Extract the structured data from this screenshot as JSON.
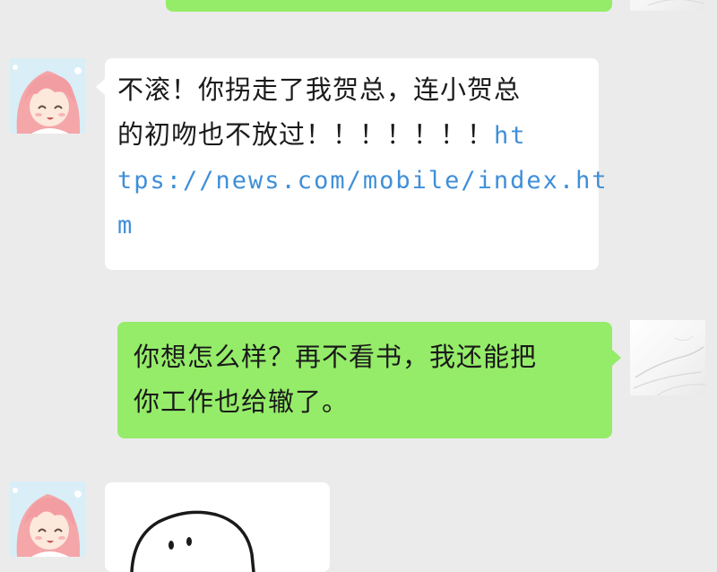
{
  "chat": {
    "messages": [
      {
        "side": "right",
        "type": "text",
        "lines": []
      },
      {
        "side": "left",
        "type": "text",
        "text_part": "不滚！你拐走了我贺总，连小贺总的初吻也不放过！！！！！！！",
        "line1": "不滚！你拐走了我贺总，连小贺总",
        "line2_text": "的初吻也不放过！！！！！！！",
        "line2_link": "ht",
        "line3_link": "tps://news.com/mobile/index.ht",
        "line4_link": "m",
        "link_color": "#3f8fd8"
      },
      {
        "side": "right",
        "type": "text",
        "line1": "你想怎么样？再不看书，我还能把",
        "line2": "你工作也给辙了。"
      },
      {
        "side": "left",
        "type": "sticker",
        "sticker_name": "blob-doodle-sticker"
      }
    ]
  },
  "colors": {
    "background": "#ebebeb",
    "bubble_self": "#95ec69",
    "bubble_other": "#ffffff",
    "link": "#3f8fd8"
  },
  "avatars": {
    "other": "anime-girl-pink-hair-avatar",
    "self": "white-sketch-avatar"
  }
}
